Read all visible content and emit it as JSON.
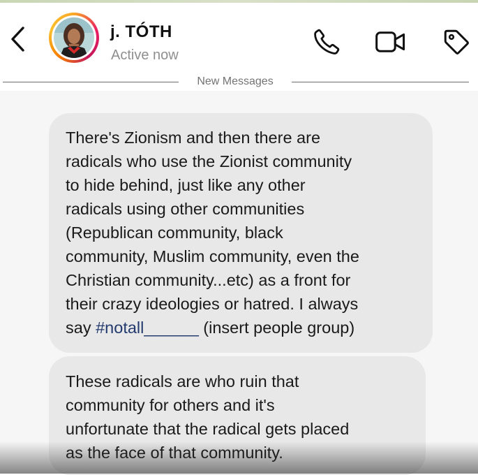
{
  "header": {
    "back_icon": "chevron-left-icon",
    "contact_name": "j. TÓTH",
    "status": "Active now",
    "call_icon": "phone-icon",
    "video_icon": "video-camera-icon",
    "tag_icon": "tag-icon"
  },
  "divider": {
    "label": "New Messages"
  },
  "messages": [
    {
      "lines": [
        "There's Zionism and then there are",
        "radicals who use the Zionist community",
        "to hide behind, just like any other",
        "radicals using other communities",
        "(Republican community, black",
        "community, Muslim community, even the",
        "Christian community...etc) as a front for",
        "their crazy ideologies or hatred. I always"
      ],
      "last_line": {
        "prefix": "say ",
        "hashtag": "#notall",
        "blank": "______",
        "suffix": " (insert people group)"
      }
    },
    {
      "lines": [
        "These radicals are who ruin that",
        "community for others and it's",
        "unfortunate that the radical gets placed",
        "as the face of that community."
      ]
    }
  ],
  "colors": {
    "bubble_bg": "#e8e8e8",
    "thread_bg": "#f6f6f6",
    "hashtag": "#233a6e",
    "status_gray": "#8e8e8e",
    "story_ring_start": "#f9a825",
    "story_ring_end": "#c2185b"
  }
}
